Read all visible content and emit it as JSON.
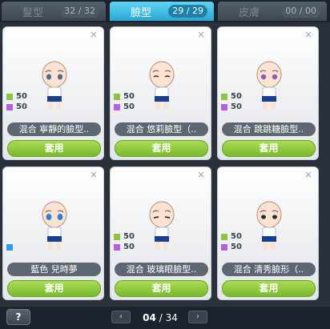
{
  "tabs": [
    {
      "label": "髮型",
      "count": "32 / 32",
      "active": false
    },
    {
      "label": "臉型",
      "count": "29 / 29",
      "active": true
    },
    {
      "label": "皮膚",
      "count": "00 / 00",
      "active": false
    }
  ],
  "cards": [
    {
      "name": "混合 寧靜的臉型..",
      "stats": [
        "50",
        "50"
      ],
      "apply": "套用"
    },
    {
      "name": "混合 悠莉臉型（..",
      "stats": [
        "50",
        "50"
      ],
      "apply": "套用"
    },
    {
      "name": "混合 跳跳糖臉型..",
      "stats": [
        "50",
        "50"
      ],
      "apply": "套用"
    },
    {
      "name": "藍色 兒時夢",
      "stats": [],
      "apply": "套用"
    },
    {
      "name": "混合 玻璃眼臉型..",
      "stats": [
        "50",
        "50"
      ],
      "apply": "套用"
    },
    {
      "name": "混合 清秀臉形（..",
      "stats": [
        "50",
        "50"
      ],
      "apply": "套用"
    }
  ],
  "close_glyph": "×",
  "help_label": "?",
  "pager": {
    "prev": "‹",
    "next": "›",
    "current": "04",
    "separator": "/",
    "total": "34"
  },
  "colors": {
    "accent_tab": "#2aa8d3",
    "apply_button": "#8cc63f",
    "stat_green": "#8cc63f",
    "stat_purple": "#b65fe0",
    "color_blue": "#2f9be8"
  }
}
